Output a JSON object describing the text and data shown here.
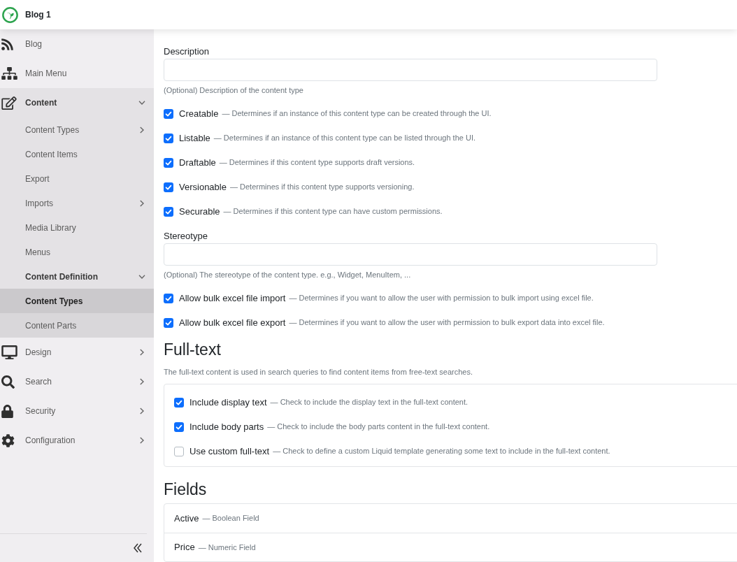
{
  "header": {
    "title": "Blog 1"
  },
  "sidebar": {
    "items": [
      {
        "label": "Blog",
        "selected": false
      },
      {
        "label": "Main Menu",
        "selected": false
      },
      {
        "label": "Content",
        "selected": false,
        "expanded": true,
        "children": [
          {
            "label": "Content Types",
            "selected": false,
            "expanded": false
          },
          {
            "label": "Content Items",
            "selected": false
          },
          {
            "label": "Export",
            "selected": false
          },
          {
            "label": "Imports",
            "selected": false,
            "expanded": false
          },
          {
            "label": "Media Library",
            "selected": false
          },
          {
            "label": "Menus",
            "selected": false
          },
          {
            "label": "Content Definition",
            "selected": false,
            "expanded": true,
            "children": [
              {
                "label": "Content Types",
                "selected": true
              },
              {
                "label": "Content Parts",
                "selected": false
              }
            ]
          }
        ]
      },
      {
        "label": "Design",
        "selected": false,
        "expanded": false
      },
      {
        "label": "Search",
        "selected": false,
        "expanded": false
      },
      {
        "label": "Security",
        "selected": false,
        "expanded": false
      },
      {
        "label": "Configuration",
        "selected": false,
        "expanded": false
      }
    ]
  },
  "form": {
    "description_field": {
      "label": "Description",
      "hint": "(Optional) Description of the content type"
    },
    "options": [
      {
        "label": "Creatable",
        "description": "— Determines if an instance of this content type can be created through the UI.",
        "checked": true
      },
      {
        "label": "Listable",
        "description": "— Determines if an instance of this content type can be listed through the UI.",
        "checked": true
      },
      {
        "label": "Draftable",
        "description": "— Determines if this content type supports draft versions.",
        "checked": true
      },
      {
        "label": "Versionable",
        "description": "— Determines if this content type supports versioning.",
        "checked": true
      },
      {
        "label": "Securable",
        "description": "— Determines if this content type can have custom permissions.",
        "checked": true
      }
    ],
    "stereotype_field": {
      "label": "Stereotype",
      "hint": "(Optional) The stereotype of the content type. e.g., Widget, MenuItem, ..."
    },
    "bulk_options": [
      {
        "label": "Allow bulk excel file import",
        "description": "— Determines if you want to allow the user with permission to bulk import using excel file.",
        "checked": true
      },
      {
        "label": "Allow bulk excel file export",
        "description": "— Determines if you want to allow the user with permission to bulk export data into excel file.",
        "checked": true
      }
    ]
  },
  "full_text": {
    "title": "Full-text",
    "description": "The full-text content is used in search queries to find content items from free-text searches.",
    "options": [
      {
        "label": "Include display text",
        "description": "— Check to include the display text in the full-text content.",
        "checked": true
      },
      {
        "label": "Include body parts",
        "description": "— Check to include the body parts content in the full-text content.",
        "checked": true
      },
      {
        "label": "Use custom full-text",
        "description": "— Check to define a custom Liquid template generating some text to include in the full-text content.",
        "checked": false
      }
    ]
  },
  "fields": {
    "title": "Fields",
    "items": [
      {
        "name": "Active",
        "description": "— Boolean Field"
      },
      {
        "name": "Price",
        "description": "— Numeric Field"
      }
    ]
  }
}
